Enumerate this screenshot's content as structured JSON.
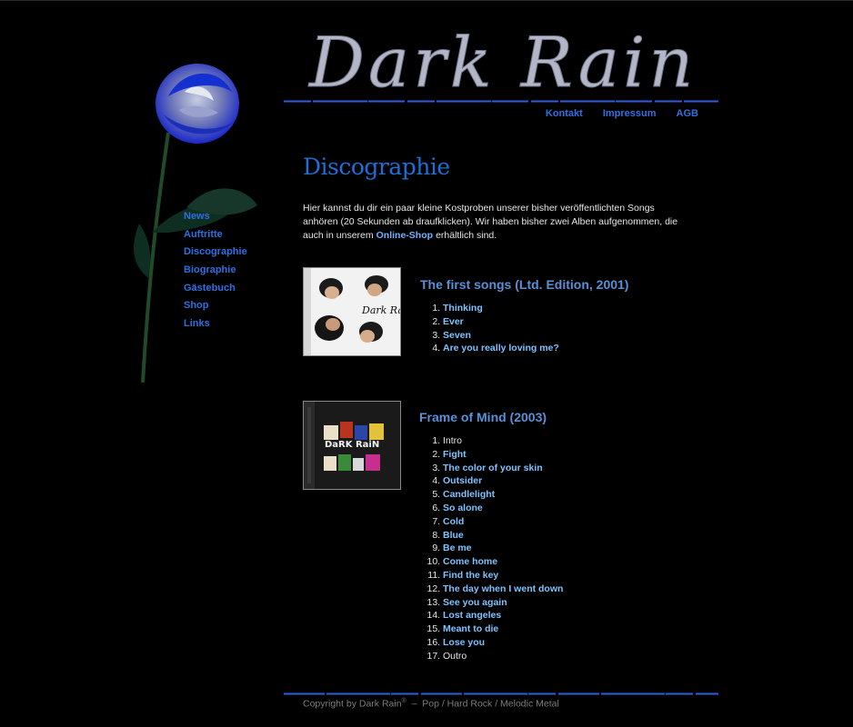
{
  "header": {
    "logo_text": "Dark Rain",
    "top_nav": [
      "Kontakt",
      "Impressum",
      "AGB"
    ]
  },
  "sidebar": {
    "items": [
      "News",
      "Auftritte",
      "Discographie",
      "Biographie",
      "Gästebuch",
      "Shop",
      "Links"
    ]
  },
  "main": {
    "title": "Discographie",
    "intro_before": "Hier kannst du dir ein paar kleine Kostproben unserer bisher veröffentlichten Songs anhören (20 Sekunden ab draufklicken). Wir haben bisher zwei Alben aufgenommen, die auch in unserem",
    "intro_link": "Online-Shop",
    "intro_after": "erhältlich sind.",
    "albums": [
      {
        "title": "The first songs (Ltd. Edition, 2001)",
        "cover_text": "Dark Rain",
        "tracks": [
          {
            "name": "Thinking",
            "link": true
          },
          {
            "name": "Ever",
            "link": true
          },
          {
            "name": "Seven",
            "link": true
          },
          {
            "name": "Are you really loving me?",
            "link": true
          }
        ]
      },
      {
        "title": "Frame of Mind (2003)",
        "cover_text": "DaRK RaiN",
        "tracks": [
          {
            "name": "Intro",
            "link": false
          },
          {
            "name": "Fight",
            "link": true
          },
          {
            "name": "The color of your skin",
            "link": true
          },
          {
            "name": "Outsider",
            "link": true
          },
          {
            "name": "Candlelight",
            "link": true
          },
          {
            "name": "So alone",
            "link": true
          },
          {
            "name": "Cold",
            "link": true
          },
          {
            "name": "Blue",
            "link": true
          },
          {
            "name": "Be me",
            "link": true
          },
          {
            "name": "Come home",
            "link": true
          },
          {
            "name": "Find the key",
            "link": true
          },
          {
            "name": "The day when I went down",
            "link": true
          },
          {
            "name": "See you again",
            "link": true
          },
          {
            "name": "Lost angeles",
            "link": true
          },
          {
            "name": "Meant to die",
            "link": true
          },
          {
            "name": "Lose you",
            "link": true
          },
          {
            "name": "Outro",
            "link": false
          }
        ]
      }
    ]
  },
  "footer": {
    "copyright": "Copyright by Dark Rain",
    "mark": "®",
    "separator": "–",
    "genre": "Pop / Hard Rock / Melodic Metal"
  },
  "colors": {
    "background": "#000000",
    "nav_link": "#2f6fe0",
    "heading": "#1e6fd8",
    "track_link": "#7ec3ff",
    "album_title": "#5b8fd6"
  }
}
